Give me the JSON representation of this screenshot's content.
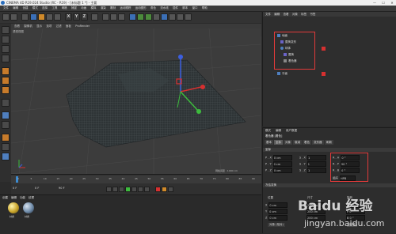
{
  "window": {
    "title": "CINEMA 4D R19.024 Studio (RC - R19) - [未标题 1 *] - 主要",
    "controls": [
      "—",
      "☐",
      "✕"
    ]
  },
  "menubar": {
    "items": [
      "文件",
      "编辑",
      "创建",
      "模式",
      "选择",
      "工具",
      "网格",
      "捕捉",
      "动画",
      "模拟",
      "渲染",
      "雕刻",
      "运动跟踪",
      "运动图形",
      "角色",
      "流水线",
      "插件",
      "脚本",
      "窗口",
      "帮助"
    ]
  },
  "toolbar": {
    "xyz": [
      "X",
      "Y",
      "Z"
    ]
  },
  "viewport": {
    "menu": [
      "查看",
      "摄像机",
      "显示",
      "选项",
      "过滤",
      "面板",
      "ProRender"
    ],
    "label": "透视视图",
    "grid_info": "网格间距 : 1000 cm"
  },
  "objects": {
    "tabs": [
      "文件",
      "编辑",
      "查看",
      "对象",
      "标签",
      "书签"
    ],
    "rows": [
      "地面",
      "置换变形",
      "球体",
      "置换",
      "着色器",
      "平面"
    ]
  },
  "attributes": {
    "tabs": [
      "模式",
      "编辑",
      "用户数据"
    ],
    "header": "着色器 [着色]",
    "subtabs": [
      "基本",
      "坐标",
      "对象",
      "衰减",
      "着色",
      "变形器",
      "刷新"
    ],
    "section": "坐标",
    "fields": [
      {
        "label": "P . X",
        "value": "0 cm"
      },
      {
        "label": "P . Y",
        "value": "0 cm"
      },
      {
        "label": "P . Z",
        "value": "0 cm"
      },
      {
        "label": "S . X",
        "value": "1"
      },
      {
        "label": "S . Y",
        "value": "1"
      },
      {
        "label": "S . Z",
        "value": "1"
      },
      {
        "label": "R . H",
        "value": "0 °"
      },
      {
        "label": "R . P",
        "value": "90 °"
      },
      {
        "label": "R . B",
        "value": "0 °"
      }
    ],
    "order_label": "顺序",
    "order_value": "HPB",
    "freeze": "冻结变换"
  },
  "timeline": {
    "start": "0 F",
    "end": "90 F",
    "current": "0 F",
    "ticks": [
      "0",
      "5",
      "10",
      "15",
      "20",
      "25",
      "30",
      "35",
      "40",
      "45",
      "50",
      "55",
      "60",
      "65",
      "70",
      "75",
      "80",
      "85",
      "90"
    ]
  },
  "materials": {
    "tabs": [
      "创建",
      "编辑",
      "功能",
      "纹理"
    ],
    "items": [
      "材质",
      "材质"
    ]
  },
  "coordinates": {
    "headers": [
      "位置",
      "尺寸",
      "旋转"
    ],
    "rows": [
      {
        "axis": "X",
        "pos": "0 cm",
        "size": "200 cm",
        "rot": "H  0 °"
      },
      {
        "axis": "Y",
        "pos": "0 cm",
        "size": "200 cm",
        "rot": "P  0 °"
      },
      {
        "axis": "Z",
        "pos": "0 cm",
        "size": "200 cm",
        "rot": "B  0 °"
      }
    ],
    "mode": "对象 (相对)",
    "apply": "应用"
  },
  "watermark": {
    "brand": "Baidu 经验",
    "url": "jingyan.baidu.com"
  },
  "colors": {
    "accent_red": "#e13a3a",
    "axis_green": "#3dbb3d",
    "axis_blue": "#3c5fe0",
    "axis_red": "#d63030"
  }
}
